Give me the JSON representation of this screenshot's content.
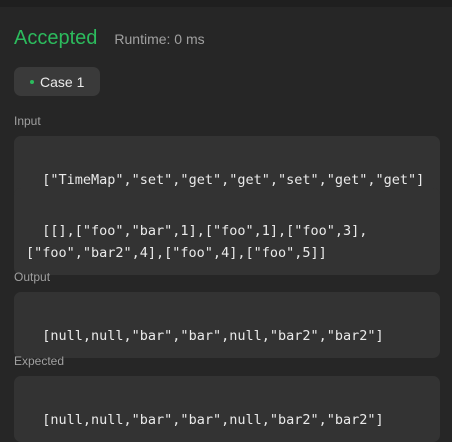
{
  "result": {
    "status": "Accepted",
    "runtime": "Runtime: 0 ms",
    "status_color": "#2cbb5d"
  },
  "case_tab": {
    "label": "Case 1"
  },
  "input": {
    "label": "Input",
    "line1": "[\"TimeMap\",\"set\",\"get\",\"get\",\"set\",\"get\",\"get\"]",
    "line2": "[[],[\"foo\",\"bar\",1],[\"foo\",1],[\"foo\",3],[\"foo\",\"bar2\",4],[\"foo\",4],[\"foo\",5]]"
  },
  "output": {
    "label": "Output",
    "value": "[null,null,\"bar\",\"bar\",null,\"bar2\",\"bar2\"]"
  },
  "expected": {
    "label": "Expected",
    "value": "[null,null,\"bar\",\"bar\",null,\"bar2\",\"bar2\"]"
  }
}
